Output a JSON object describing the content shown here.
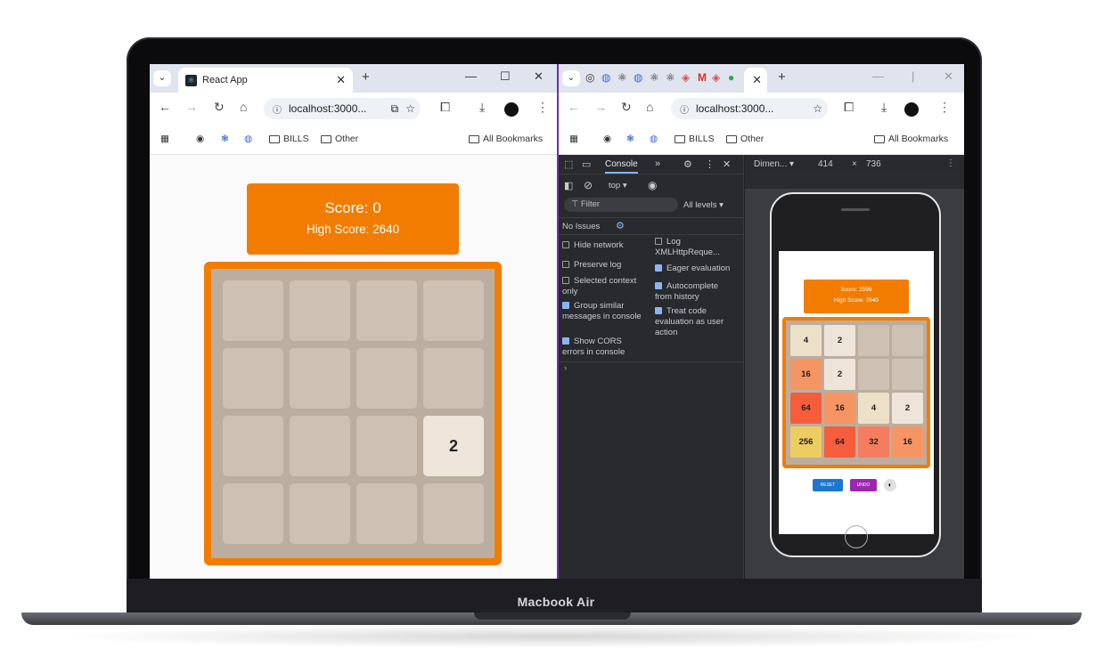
{
  "device": {
    "label": "Macbook Air"
  },
  "left_browser": {
    "tab_title": "React App",
    "url": "localhost:3000...",
    "bookmarks": [
      "BILLS",
      "Other"
    ],
    "all_bookmarks": "All Bookmarks"
  },
  "game": {
    "score_label": "Score: 0",
    "high_score_label": "High Score: 2640",
    "board": [
      [
        "",
        "",
        "",
        ""
      ],
      [
        "",
        "",
        "",
        ""
      ],
      [
        "",
        "",
        "",
        "2"
      ],
      [
        "",
        "",
        "",
        ""
      ]
    ]
  },
  "right_browser": {
    "url": "localhost:3000...",
    "bookmarks": [
      "BILLS",
      "Other"
    ],
    "all_bookmarks": "All Bookmarks"
  },
  "devtools": {
    "tab_console": "Console",
    "context": "top",
    "filter_placeholder": "Filter",
    "levels": "All levels ▾",
    "issues": "No Issues",
    "options_left": [
      {
        "label": "Hide network",
        "checked": false
      },
      {
        "label": "Preserve log",
        "checked": false
      },
      {
        "label": "Selected context only",
        "checked": false
      },
      {
        "label": "Group similar messages in console",
        "checked": true
      },
      {
        "label": "Show CORS errors in console",
        "checked": true
      }
    ],
    "options_right": [
      {
        "label": "Log XMLHttpReque...",
        "checked": false
      },
      {
        "label": "Eager evaluation",
        "checked": true
      },
      {
        "label": "Autocomplete from history",
        "checked": true
      },
      {
        "label": "Treat code evaluation as user action",
        "checked": true
      }
    ],
    "prompt": "›"
  },
  "device_toolbar": {
    "dimensions": "Dimen...",
    "width": "414",
    "times": "×",
    "height": "736"
  },
  "phone_game": {
    "score_label": "Score: 2596",
    "high_score_label": "High Score: 2640",
    "board": [
      [
        "4",
        "2",
        "",
        ""
      ],
      [
        "16",
        "2",
        "",
        ""
      ],
      [
        "64",
        "16",
        "4",
        "2"
      ],
      [
        "256",
        "64",
        "32",
        "16"
      ]
    ],
    "reset_label": "RESET",
    "undo_label": "UNDO"
  },
  "colors": {
    "accent": "#f27c00",
    "board_bg": "#bbada0",
    "empty_cell": "#cdc1b4",
    "tile_2": "#eee4da"
  }
}
